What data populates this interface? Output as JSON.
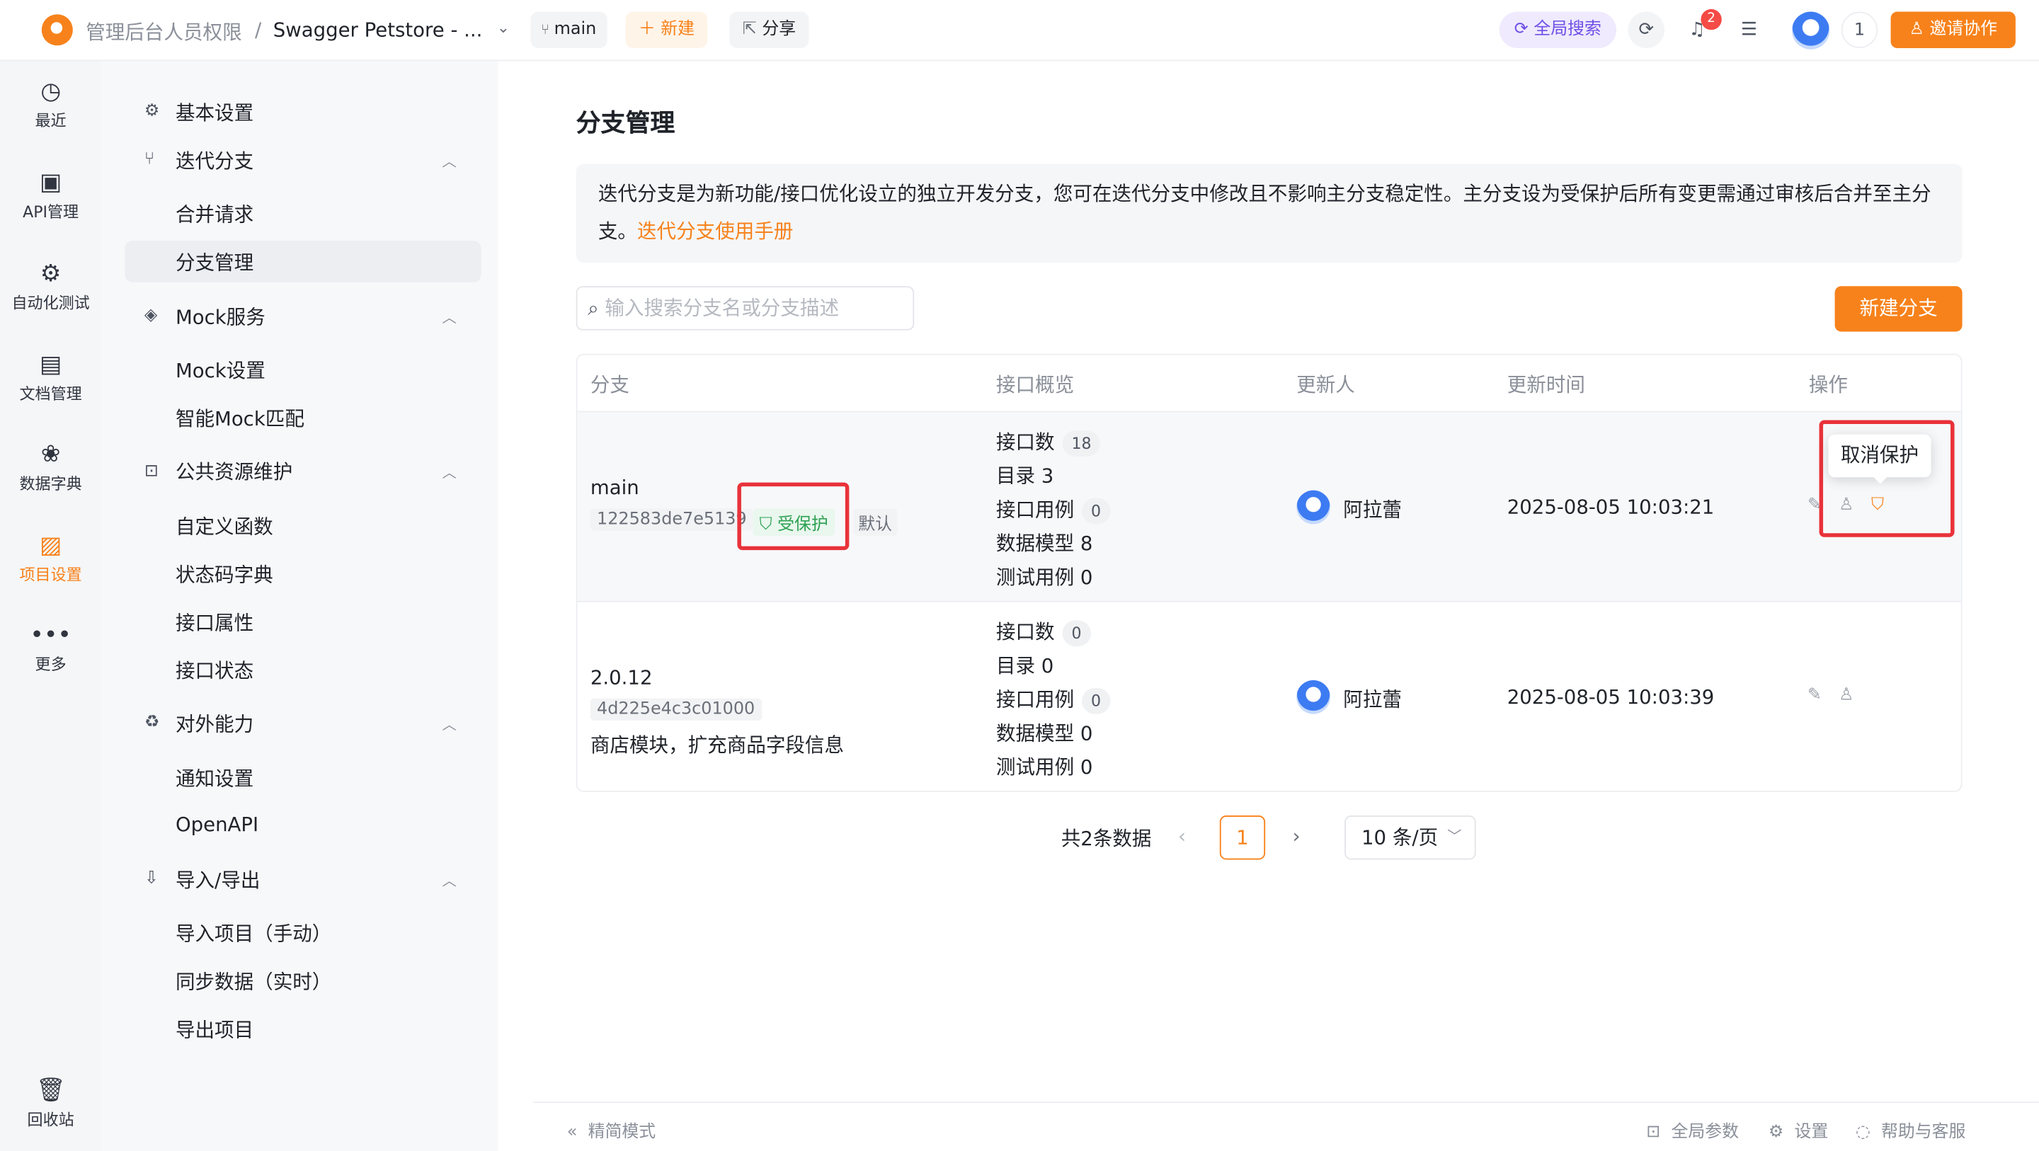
{
  "topbar": {
    "org": "管理后台人员权限",
    "separator": "/",
    "project": "Swagger Petstore - ...",
    "branch": "main",
    "new_label": "新建",
    "share_label": "分享",
    "global_search": "全局搜索",
    "notification_count": "2",
    "user_count": "1",
    "invite_label": "邀请协作"
  },
  "rail": {
    "items": [
      {
        "label": "最近",
        "icon": "history-icon"
      },
      {
        "label": "API管理",
        "icon": "api-icon"
      },
      {
        "label": "自动化测试",
        "icon": "automation-icon"
      },
      {
        "label": "文档管理",
        "icon": "document-icon"
      },
      {
        "label": "数据字典",
        "icon": "dictionary-icon"
      },
      {
        "label": "项目设置",
        "icon": "settings-icon"
      },
      {
        "label": "更多",
        "icon": "more-icon"
      }
    ],
    "recycle": "回收站"
  },
  "sidebar": {
    "basic": "基本设置",
    "iter": "迭代分支",
    "merge": "合并请求",
    "branch_mgmt": "分支管理",
    "mock": "Mock服务",
    "mock_settings": "Mock设置",
    "smart_mock": "智能Mock匹配",
    "public": "公共资源维护",
    "custom_fn": "自定义函数",
    "status_dict": "状态码字典",
    "iface_attr": "接口属性",
    "iface_status": "接口状态",
    "external": "对外能力",
    "notify": "通知设置",
    "openapi": "OpenAPI",
    "io": "导入/导出",
    "import_manual": "导入项目（手动）",
    "sync": "同步数据（实时）",
    "export": "导出项目"
  },
  "main": {
    "title": "分支管理",
    "notice": "迭代分支是为新功能/接口优化设立的独立开发分支，您可在迭代分支中修改且不影响主分支稳定性。主分支设为受保护后所有变更需通过审核后合并至主分支。",
    "notice_link": "迭代分支使用手册",
    "search_placeholder": "输入搜索分支名或分支描述",
    "new_branch": "新建分支",
    "columns": [
      "分支",
      "接口概览",
      "更新人",
      "更新时间",
      "操作"
    ],
    "rows": [
      {
        "name": "main",
        "hash": "122583de7e5139",
        "protected": "受保护",
        "default": "默认",
        "desc": "",
        "api_label": "接口数",
        "api_count": "18",
        "dir": "目录 3",
        "case_label": "接口用例",
        "case_count": "0",
        "model": "数据模型 8",
        "test": "测试用例 0",
        "user": "阿拉蕾",
        "time": "2025-08-05 10:03:21"
      },
      {
        "name": "2.0.12",
        "hash": "4d225e4c3c01000",
        "protected": "",
        "default": "",
        "desc": "商店模块，扩充商品字段信息",
        "api_label": "接口数",
        "api_count": "0",
        "dir": "目录 0",
        "case_label": "接口用例",
        "case_count": "0",
        "model": "数据模型 0",
        "test": "测试用例 0",
        "user": "阿拉蕾",
        "time": "2025-08-05 10:03:39"
      }
    ],
    "tooltip": "取消保护",
    "total": "共2条数据",
    "page": "1",
    "page_size": "10 条/页"
  },
  "bottom": {
    "simple": "精简模式",
    "global_params": "全局参数",
    "settings": "设置",
    "help": "帮助与客服"
  },
  "colors": {
    "accent": "#f7821b",
    "protected": "#2ea152",
    "highlight": "#e9323a"
  }
}
